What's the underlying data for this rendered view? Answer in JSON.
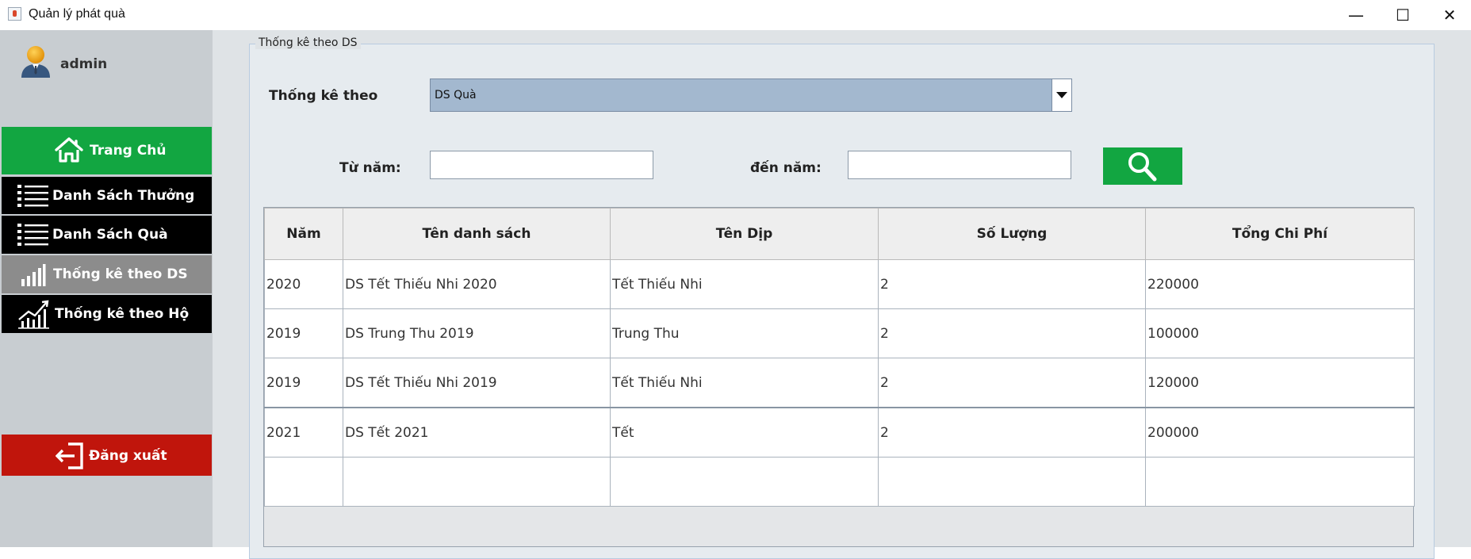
{
  "window": {
    "title": "Quản lý phát quà",
    "minimize": "—",
    "maximize": "☐",
    "close": "✕"
  },
  "sidebar": {
    "user": "admin",
    "items": [
      {
        "label": "Trang Chủ",
        "icon": "home-icon"
      },
      {
        "label": "Danh Sách Thưởng",
        "icon": "list-icon"
      },
      {
        "label": "Danh Sách Quà",
        "icon": "list-icon"
      },
      {
        "label": "Thống kê theo DS",
        "icon": "bar-chart-icon"
      },
      {
        "label": "Thống kê theo Hộ",
        "icon": "growth-chart-icon"
      }
    ],
    "logout": "Đăng xuất"
  },
  "panel": {
    "title": "Thống kê theo DS",
    "stat_label": "Thống kê theo",
    "stat_value": "DS Quà",
    "from_label": "Từ năm:",
    "to_label": "đến năm:",
    "from_value": "",
    "to_value": ""
  },
  "table": {
    "headers": [
      "Năm",
      "Tên danh sách",
      "Tên Dịp",
      "Số Lượng",
      "Tổng Chi Phí"
    ],
    "rows": [
      [
        "2020",
        "DS Tết Thiếu Nhi 2020",
        "Tết Thiếu Nhi",
        "2",
        "220000"
      ],
      [
        "2019",
        "DS Trung Thu 2019",
        "Trung Thu",
        "2",
        "100000"
      ],
      [
        "2019",
        "DS Tết Thiếu Nhi 2019",
        "Tết Thiếu Nhi",
        "2",
        "120000"
      ],
      [
        "2021",
        "DS Tết 2021",
        "Tết",
        "2",
        "200000"
      ],
      [
        "",
        "",
        "",
        "",
        ""
      ]
    ]
  },
  "colors": {
    "home": "#12a641",
    "nav_dark": "#000000",
    "nav_active": "#8c8c8c",
    "logout": "#c0150c",
    "combo": "#a3b8cf"
  }
}
